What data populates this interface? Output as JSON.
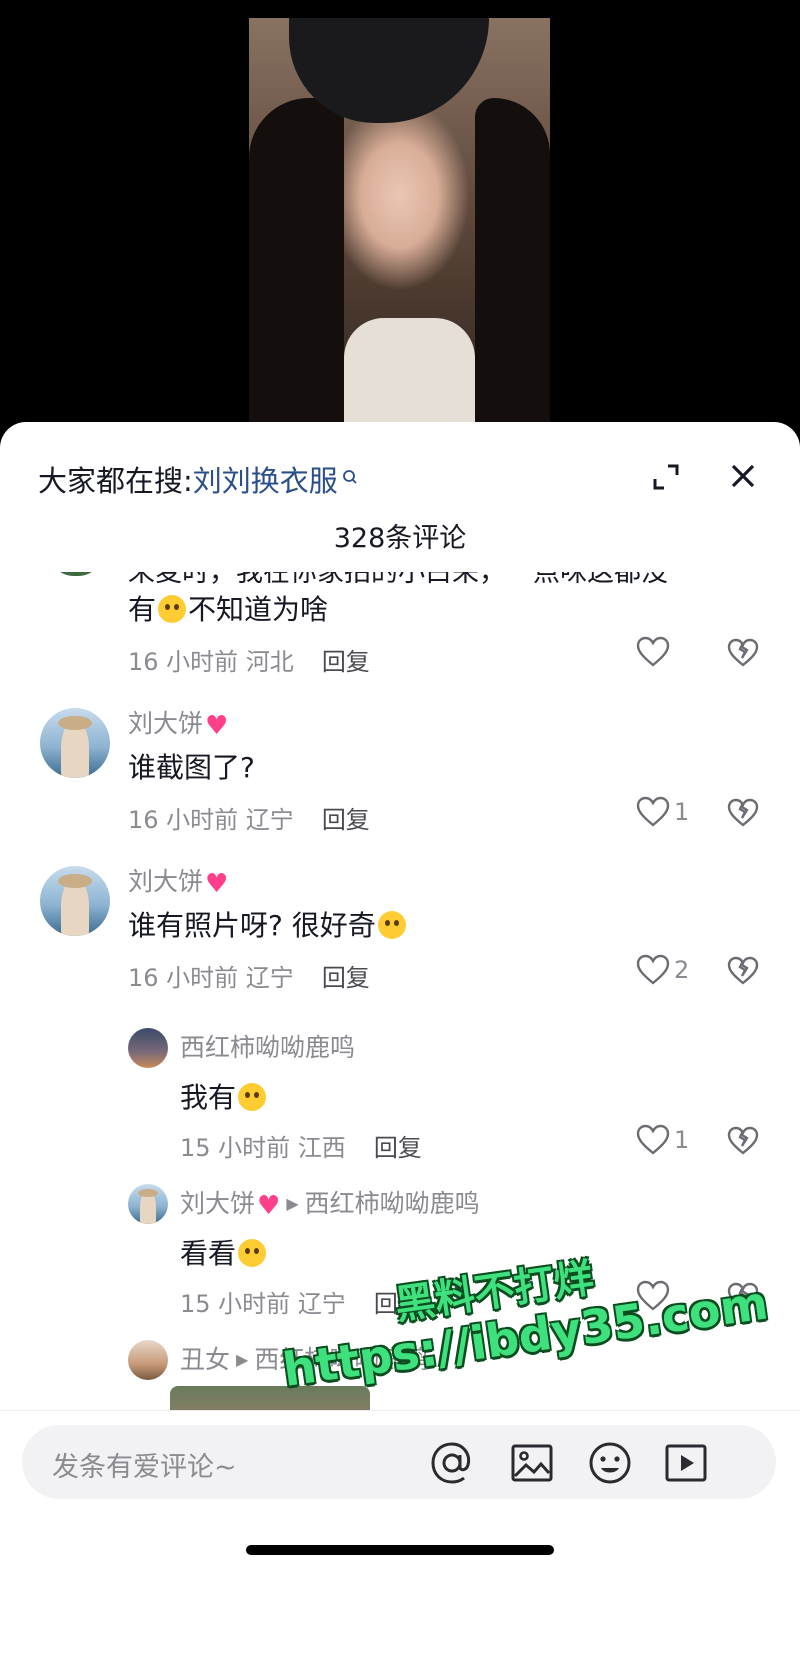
{
  "header": {
    "search_prefix": "大家都在搜:",
    "search_term": "刘刘换衣服",
    "comment_count": "328条评论"
  },
  "partial_comment": {
    "cut_text": "来麦时，我在你家拍的小白采，一点咪这都没",
    "text_line2": "有",
    "text_line2_suffix": "不知道为啥",
    "time": "16 小时前",
    "location": "河北",
    "reply_label": "回复"
  },
  "comments": [
    {
      "name": "刘大饼",
      "text": "谁截图了?",
      "time": "16 小时前",
      "location": "辽宁",
      "reply_label": "回复",
      "likes": "1"
    },
    {
      "name": "刘大饼",
      "text": "谁有照片呀? 很好奇",
      "time": "16 小时前",
      "location": "辽宁",
      "reply_label": "回复",
      "likes": "2"
    }
  ],
  "replies": [
    {
      "name": "西红柿呦呦鹿鸣",
      "text": "我有",
      "time": "15 小时前",
      "location": "江西",
      "reply_label": "回复",
      "likes": "1"
    },
    {
      "name": "刘大饼",
      "reply_to": "西红柿呦呦鹿鸣",
      "text": "看看",
      "time": "15 小时前",
      "location": "辽宁",
      "reply_label": "回复",
      "likes": ""
    },
    {
      "name": "丑女",
      "reply_to": "西红柿呦呦鹿鸣"
    }
  ],
  "input": {
    "placeholder": "发条有爱评论~"
  },
  "watermark": {
    "line1": "黑料不打烊",
    "line2": "https://ibdy35.com"
  },
  "colors": {
    "accent_link": "#2b4f8a",
    "muted_text": "#8a8b91",
    "watermark_green": "#3fe07e"
  },
  "icons": [
    "search-icon",
    "expand-icon",
    "close-icon",
    "heart-icon",
    "dislike-heart-icon",
    "at-icon",
    "image-icon",
    "emoji-icon",
    "play-icon"
  ]
}
